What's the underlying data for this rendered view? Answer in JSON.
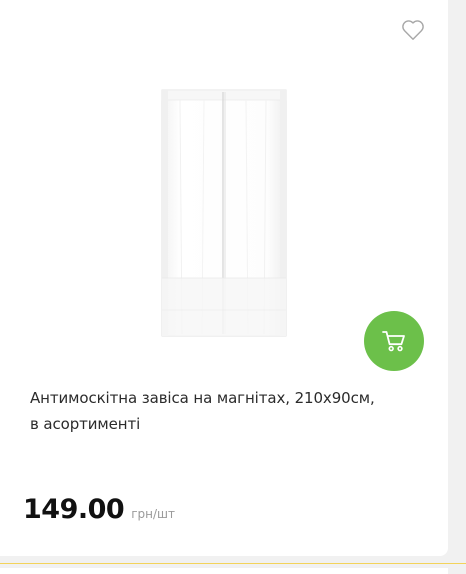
{
  "product": {
    "title_line1": "Антимоскітна завіса на магнітах, 210х90см,",
    "title_line2": "в асортименті",
    "price": "149.00",
    "unit": "грн/шт"
  },
  "icons": {
    "wishlist": "heart-outline-icon",
    "cart": "shopping-cart-icon"
  },
  "colors": {
    "cart_button": "#6cc04a",
    "accent_line": "#f3d35a",
    "price": "#111111",
    "unit": "#9a9a9a"
  }
}
